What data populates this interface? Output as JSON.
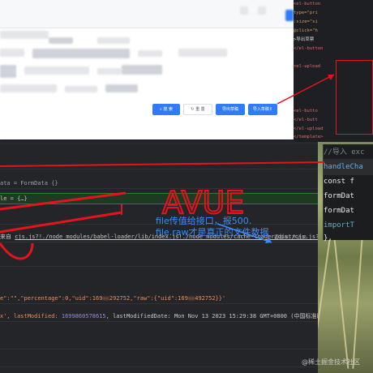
{
  "app": {
    "buttons": {
      "search": "搜 索",
      "reset": "重 置",
      "export": "导出草稿",
      "import": "导入草稿"
    },
    "icons": {
      "search": "search-icon",
      "reset": "refresh-icon",
      "import": "upload-icon"
    }
  },
  "editor": {
    "lines": [
      "<el-button",
      "  type=\"pri",
      "  :size=\"si",
      "  @click=\"h",
      ">导出草票",
      "</el-button",
      "",
      "<el-upload",
      "",
      "",
      "",
      "",
      "  <el-butto",
      "  </el-butt",
      "</el-upload",
      "</template>"
    ]
  },
  "snippet": {
    "lines": [
      "//导入 exc",
      "handleCha",
      "  const f",
      "  formDat",
      "  formDat",
      "  importT",
      "},"
    ]
  },
  "console": {
    "formdata_line": "ata = FormData {}",
    "file_line": "le = {…}",
    "source_line_prefix": "来自 ",
    "source_link": "cjs.js?!./node_modules/babel-loader/lib/index.js!./node_modules/cache-loader/dist/cjs.js??ref--0-1!./node_mo...",
    "source_suffix": "覆盖率: 不适用",
    "raw_line_prefix": "e\":\"\",\"percentage\":0,\"uid\":169",
    "raw_line_mid": "292752,\"raw\":{\"uid\":169",
    "raw_line_end": "492752}}'",
    "file_detail_prefix": "x', lastModified: ",
    "last_modified": "1699860578615",
    "file_detail_suffix": ", lastModifiedDate: Mon Nov 13 2023 15:29:38 GMT+0800 (中国标准时间"
  },
  "annotation": {
    "line1": "file传值给接口，报500.",
    "line2": "file.raw才是真正的文件数据",
    "scribble": "AVUE"
  },
  "watermark": "@稀土掘金技术社区",
  "colors": {
    "primary": "#2f7cf6",
    "annotation_red": "#e4141b",
    "annotation_blue": "#3a8cff",
    "console_bg": "#242528",
    "highlight_green": "#2e7d32"
  }
}
